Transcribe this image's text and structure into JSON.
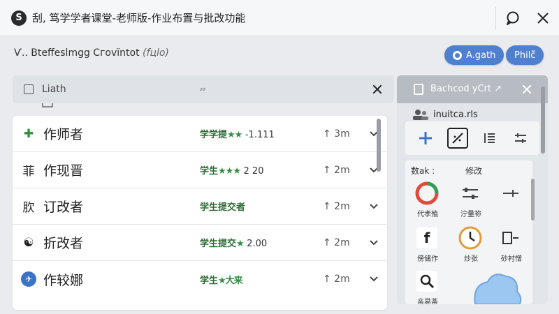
{
  "app": {
    "logo_glyph": "S",
    "title": "刮, 笃学学者课堂-老师版-作业布置与批改功能"
  },
  "subheader": {
    "left_text": "Ѵ.. Βteffeslmgg Cгovїntot",
    "modifier": "(fцlo)"
  },
  "pills": [
    {
      "label": "A.gath",
      "has_icon": true
    },
    {
      "label": "Philč̈",
      "has_icon": false
    }
  ],
  "filter": {
    "label": "Liath",
    "mid_text": "⸗⸗"
  },
  "rows": [
    {
      "icon": "puzzle-icon",
      "icon_glyph": "✚",
      "icon_color": "#2f8f3f",
      "name": "作师者",
      "status": "学学提",
      "stars": "★★",
      "score": "-1.111",
      "time": "↑ 3m"
    },
    {
      "icon": "grid-icon",
      "icon_glyph": "菲",
      "icon_color": "#222",
      "name": "作现晋",
      "status": "学生",
      "stars": "★★★",
      "score": "2 20",
      "time": "↑ 2m"
    },
    {
      "icon": "text-icon",
      "icon_glyph": "肷",
      "icon_color": "#222",
      "name": "订改者",
      "status": "学生提交者",
      "stars": "",
      "score": "",
      "time": "↑ 2m"
    },
    {
      "icon": "mask-icon",
      "icon_glyph": "☯",
      "icon_color": "#333",
      "name": "折改者",
      "status": "学生提交",
      "stars": "★",
      "score": "2.00",
      "time": "↑ 2m"
    },
    {
      "icon": "globe-icon",
      "icon_glyph": "✈",
      "icon_color": "#3b73c9",
      "name": "作较娜",
      "status": "学生",
      "stars": "★大来",
      "score": "",
      "time": "↑ 2m"
    }
  ],
  "right_panel": {
    "title": "Bachcod yCrt ↗",
    "user_label": "inuitca.rls",
    "grid_head_left": "数ak :",
    "grid_head_right": "修改",
    "cells": [
      {
        "icon": "donut-chart-icon",
        "label": "代孝殖"
      },
      {
        "icon": "sliders-icon",
        "label": "泞量祢"
      },
      {
        "icon": "minus-plus-icon",
        "label": ""
      },
      {
        "icon": "facebook-icon",
        "label": "傍储作"
      },
      {
        "icon": "clock-icon",
        "label": "炒张"
      },
      {
        "icon": "battery-icon",
        "label": "砂衬憎"
      },
      {
        "icon": "search-icon",
        "label": "亲易荼"
      },
      {
        "icon": "cloud-icon",
        "label": ""
      }
    ]
  },
  "colors": {
    "accent": "#4f7fcf",
    "green": "#2f8f3f",
    "panel_header": "#b7bcc3"
  }
}
